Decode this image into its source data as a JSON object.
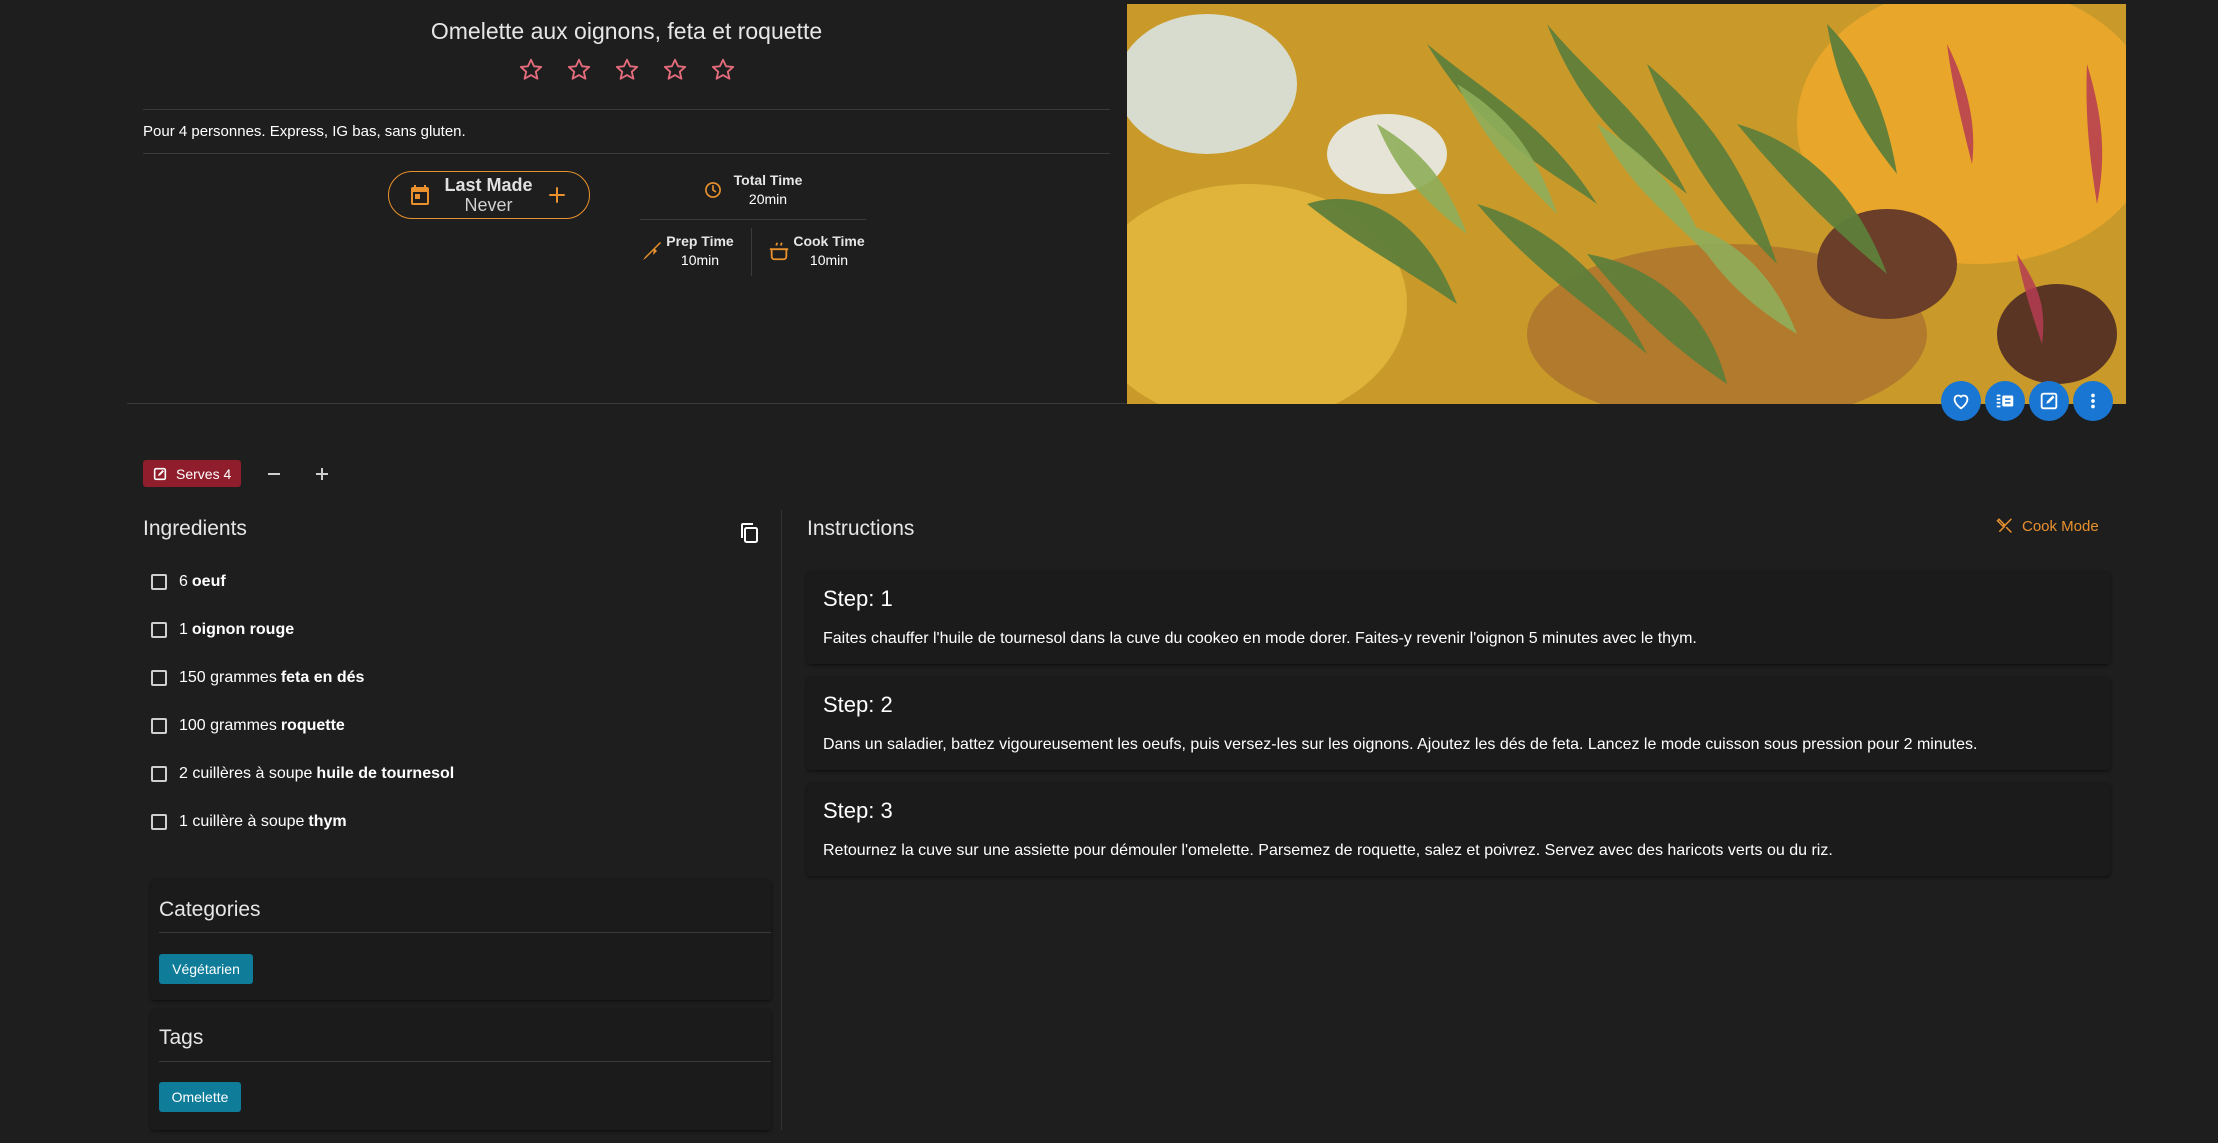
{
  "recipe": {
    "title": "Omelette aux oignons, feta et roquette",
    "rating": {
      "value": 0,
      "max": 5
    },
    "description": "Pour 4 personnes. Express, IG bas, sans gluten."
  },
  "last_made": {
    "label": "Last Made",
    "value": "Never"
  },
  "times": {
    "total": {
      "label": "Total Time",
      "value": "20min"
    },
    "prep": {
      "label": "Prep Time",
      "value": "10min"
    },
    "cook": {
      "label": "Cook Time",
      "value": "10min"
    }
  },
  "actions": {
    "icons": [
      "heart-icon",
      "playlist-icon",
      "edit-icon",
      "more-vert-icon"
    ]
  },
  "serves": {
    "label": "Serves 4"
  },
  "ingredients": {
    "title": "Ingredients",
    "items": [
      {
        "qty": "6",
        "name": "oeuf"
      },
      {
        "qty": "1",
        "name": "oignon rouge"
      },
      {
        "qty": "150 grammes",
        "name": "feta en dés"
      },
      {
        "qty": "100 grammes",
        "name": "roquette"
      },
      {
        "qty": "2 cuillères à soupe",
        "name": "huile de tournesol"
      },
      {
        "qty": "1 cuillère à soupe",
        "name": "thym"
      }
    ]
  },
  "categories": {
    "title": "Categories",
    "items": [
      "Végétarien"
    ]
  },
  "tags": {
    "title": "Tags",
    "items": [
      "Omelette"
    ]
  },
  "instructions": {
    "title": "Instructions",
    "cook_mode": "Cook Mode",
    "steps": [
      {
        "title": "Step: 1",
        "text": "Faites chauffer l'huile de tournesol dans la cuve du cookeo en mode dorer. Faites-y revenir l'oignon 5 minutes avec le thym."
      },
      {
        "title": "Step: 2",
        "text": "Dans un saladier, battez vigoureusement les oeufs, puis versez-les sur les oignons. Ajoutez les dés de feta. Lancez le mode cuisson sous pression pour 2 minutes."
      },
      {
        "title": "Step: 3",
        "text": "Retournez la cuve sur une assiette pour démouler l'omelette. Parsemez de roquette, salez et poivrez. Servez avec des haricots verts ou du riz."
      }
    ]
  },
  "colors": {
    "accent": "#e8912d",
    "primary": "#1976d2",
    "serves_bg": "#8f1d2c",
    "chip_bg": "#0f7c99",
    "star": "#e36b7b",
    "background": "#1e1e1e"
  }
}
